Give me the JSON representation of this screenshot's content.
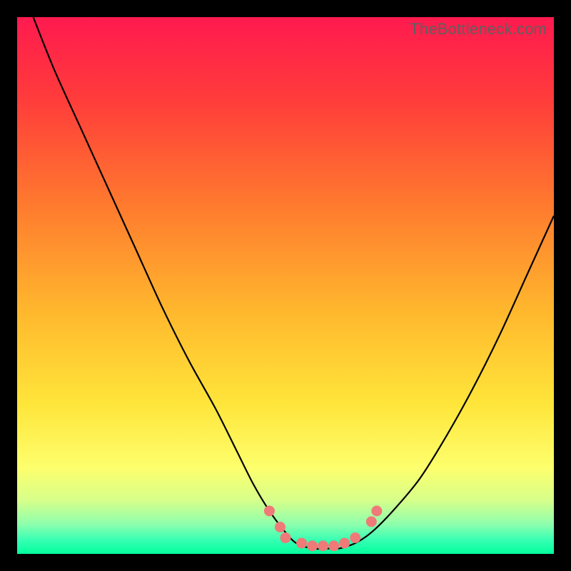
{
  "watermark": "TheBottleneck.com",
  "colors": {
    "frame_bg": "#000000",
    "curve": "#000000",
    "marker_fill": "#ef7a78",
    "marker_stroke": "#c94f4e",
    "gradient_stops": [
      {
        "offset": 0.0,
        "color": "#ff1a4f"
      },
      {
        "offset": 0.15,
        "color": "#ff3b3b"
      },
      {
        "offset": 0.35,
        "color": "#ff7a2e"
      },
      {
        "offset": 0.55,
        "color": "#ffb82d"
      },
      {
        "offset": 0.72,
        "color": "#ffe53a"
      },
      {
        "offset": 0.84,
        "color": "#fdff6d"
      },
      {
        "offset": 0.9,
        "color": "#d7ff8a"
      },
      {
        "offset": 0.945,
        "color": "#8dffad"
      },
      {
        "offset": 0.975,
        "color": "#35ffb3"
      },
      {
        "offset": 1.0,
        "color": "#03ff9d"
      }
    ]
  },
  "chart_data": {
    "type": "line",
    "title": "",
    "xlabel": "",
    "ylabel": "",
    "xlim": [
      0,
      100
    ],
    "ylim": [
      0,
      100
    ],
    "grid": false,
    "legend": false,
    "series": [
      {
        "name": "bottleneck-curve",
        "x": [
          3,
          7,
          12,
          17,
          22,
          27,
          32,
          37,
          41,
          44,
          47,
          50,
          52,
          55,
          58,
          60,
          63,
          66,
          70,
          75,
          80,
          85,
          90,
          95,
          100
        ],
        "y": [
          100,
          90,
          79,
          68,
          57,
          46,
          36,
          27,
          19,
          13,
          8,
          4,
          2,
          1,
          1,
          1,
          2,
          4,
          8,
          14,
          22,
          31,
          41,
          52,
          63
        ]
      }
    ],
    "markers": [
      {
        "x": 47,
        "y": 8
      },
      {
        "x": 49,
        "y": 5
      },
      {
        "x": 50,
        "y": 3
      },
      {
        "x": 53,
        "y": 2
      },
      {
        "x": 55,
        "y": 1.5
      },
      {
        "x": 57,
        "y": 1.5
      },
      {
        "x": 59,
        "y": 1.5
      },
      {
        "x": 61,
        "y": 2
      },
      {
        "x": 63,
        "y": 3
      },
      {
        "x": 66,
        "y": 6
      },
      {
        "x": 67,
        "y": 8
      }
    ],
    "annotations": []
  }
}
